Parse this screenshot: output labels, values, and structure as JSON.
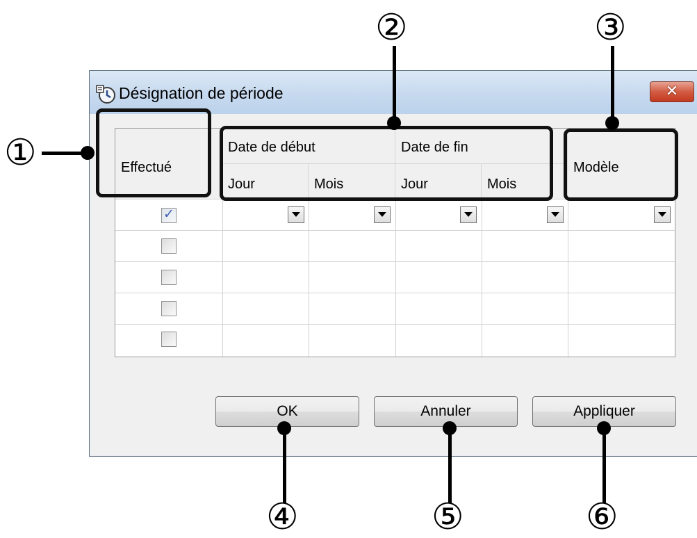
{
  "dialog": {
    "title": "Désignation de période",
    "close_label": "✕"
  },
  "grid": {
    "headers": {
      "done": "Effectué",
      "start_date": "Date de début",
      "end_date": "Date de fin",
      "day": "Jour",
      "month": "Mois",
      "model": "Modèle"
    },
    "rows": [
      {
        "done": true
      },
      {
        "done": false
      },
      {
        "done": false
      },
      {
        "done": false
      },
      {
        "done": false
      }
    ]
  },
  "buttons": {
    "ok": "OK",
    "cancel": "Annuler",
    "apply": "Appliquer"
  },
  "annotations": {
    "n1": "①",
    "n2": "②",
    "n3": "③",
    "n4": "④",
    "n5": "⑤",
    "n6": "⑥"
  }
}
